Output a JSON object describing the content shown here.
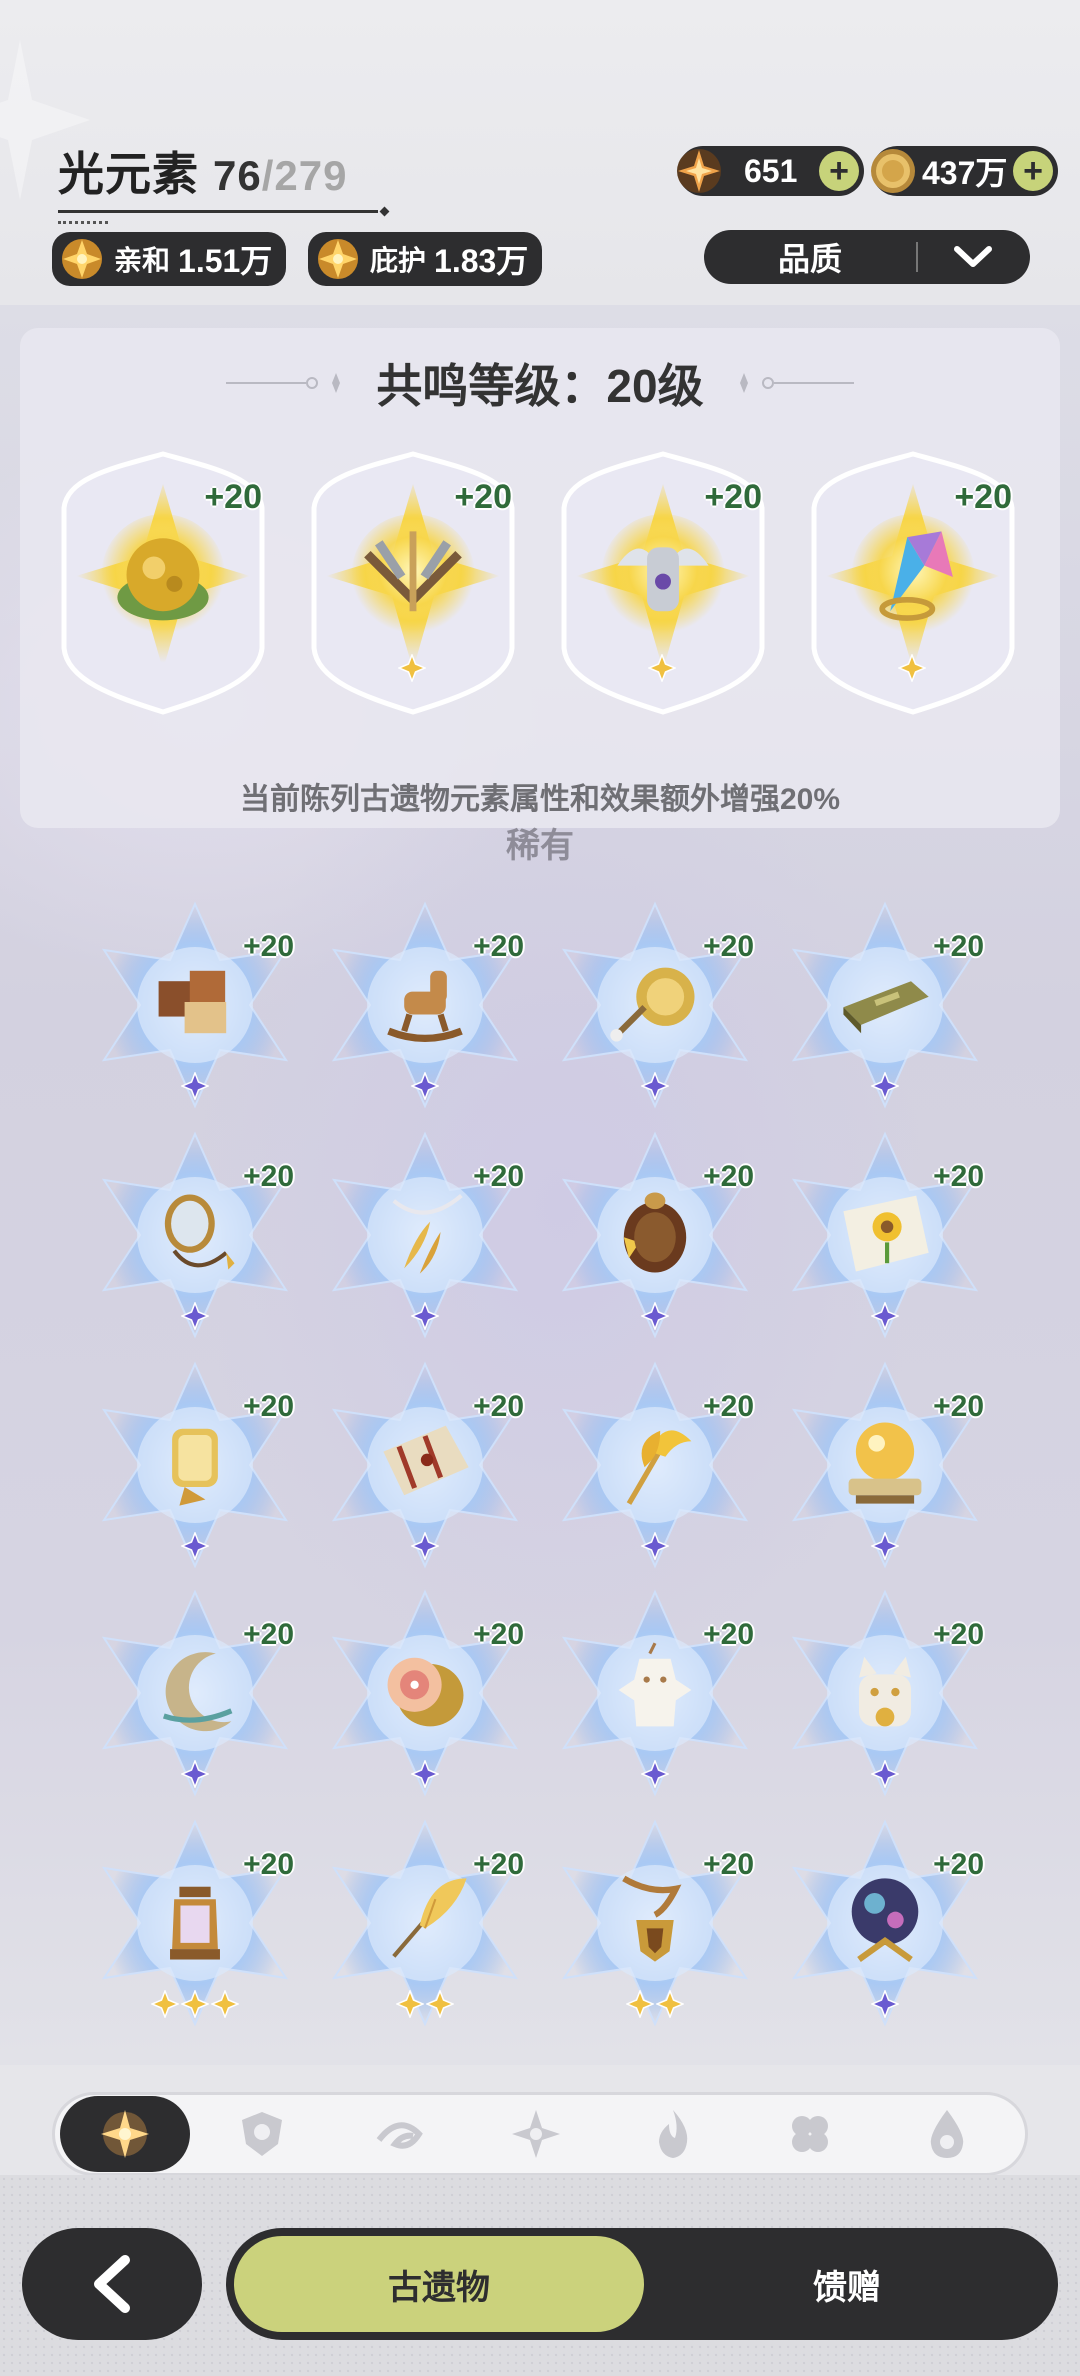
{
  "header": {
    "title": "光元素",
    "collected": "76",
    "total": "/279",
    "chips": [
      {
        "icon": "light-element-icon",
        "label": "亲和",
        "value": "1.51万"
      },
      {
        "icon": "light-element-icon",
        "label": "庇护",
        "value": "1.83万"
      }
    ],
    "currencies": [
      {
        "icon": "star-gem-icon",
        "value": "651",
        "plus": "+"
      },
      {
        "icon": "gold-coin-icon",
        "value": "437万",
        "plus": "+"
      }
    ],
    "filter": {
      "label": "品质",
      "icon": "chevron-down-icon"
    }
  },
  "resonance": {
    "title": "共鸣等级：20级",
    "note": "当前陈列古遗物元素属性和效果额外增强20%",
    "items": [
      {
        "icon": "golden-fruit-icon",
        "plus": "+20",
        "stars": 0
      },
      {
        "icon": "winged-crossbow-icon",
        "plus": "+20",
        "stars": 1
      },
      {
        "icon": "winged-helm-icon",
        "plus": "+20",
        "stars": 1
      },
      {
        "icon": "prism-crystal-icon",
        "plus": "+20",
        "stars": 1
      }
    ]
  },
  "section_label": "稀有",
  "relics": [
    {
      "icon": "wooden-puzzle-icon",
      "plus": "+20",
      "stars": 1
    },
    {
      "icon": "rocking-horse-icon",
      "plus": "+20",
      "stars": 1
    },
    {
      "icon": "gong-icon",
      "plus": "+20",
      "stars": 1
    },
    {
      "icon": "brass-plaque-icon",
      "plus": "+20",
      "stars": 1
    },
    {
      "icon": "hand-mirror-icon",
      "plus": "+20",
      "stars": 1
    },
    {
      "icon": "feather-necklace-icon",
      "plus": "+20",
      "stars": 1
    },
    {
      "icon": "star-gourd-icon",
      "plus": "+20",
      "stars": 1
    },
    {
      "icon": "sunflower-scroll-icon",
      "plus": "+20",
      "stars": 1
    },
    {
      "icon": "paper-lantern-icon",
      "plus": "+20",
      "stars": 1
    },
    {
      "icon": "sealed-scroll-icon",
      "plus": "+20",
      "stars": 1
    },
    {
      "icon": "ginkgo-hairpin-icon",
      "plus": "+20",
      "stars": 1
    },
    {
      "icon": "crystal-ball-stand-icon",
      "plus": "+20",
      "stars": 1
    },
    {
      "icon": "crescent-moon-icon",
      "plus": "+20",
      "stars": 1
    },
    {
      "icon": "fruit-drum-icon",
      "plus": "+20",
      "stars": 1
    },
    {
      "icon": "paper-doll-icon",
      "plus": "+20",
      "stars": 1
    },
    {
      "icon": "lucky-cat-icon",
      "plus": "+20",
      "stars": 1
    },
    {
      "icon": "oil-lantern-icon",
      "plus": "+20",
      "stars": 3
    },
    {
      "icon": "quill-pen-icon",
      "plus": "+20",
      "stars": 2
    },
    {
      "icon": "shield-amulet-icon",
      "plus": "+20",
      "stars": 2
    },
    {
      "icon": "galaxy-orb-icon",
      "plus": "+20",
      "stars": 1
    }
  ],
  "element_tabs": [
    {
      "icon": "light-element-icon",
      "active": true
    },
    {
      "icon": "shield-element-icon",
      "active": false
    },
    {
      "icon": "wind-element-icon",
      "active": false
    },
    {
      "icon": "flower-element-icon",
      "active": false
    },
    {
      "icon": "fire-element-icon",
      "active": false
    },
    {
      "icon": "clover-element-icon",
      "active": false
    },
    {
      "icon": "water-element-icon",
      "active": false
    }
  ],
  "bottom": {
    "back_icon": "back-arrow-icon",
    "tab_active": "古遗物",
    "tab_other": "馈赠"
  },
  "colors": {
    "dark": "#2d2d2f",
    "accent": "#cbd27c",
    "gold": "#f2c84a",
    "blue_glow": "#8fb6f0"
  }
}
